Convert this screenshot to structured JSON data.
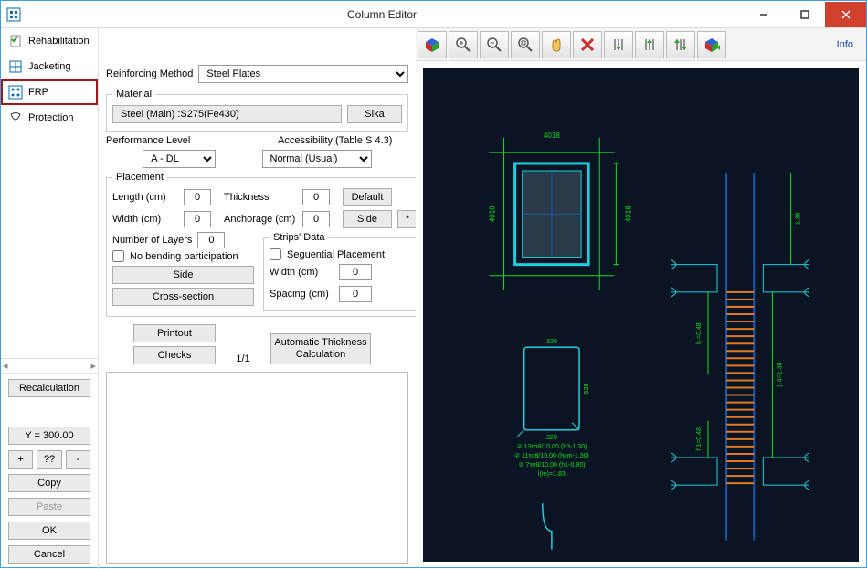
{
  "window": {
    "title": "Column Editor"
  },
  "sidebar": {
    "items": [
      {
        "label": "Rehabilitation"
      },
      {
        "label": "Jacketing"
      },
      {
        "label": "FRP"
      },
      {
        "label": "Protection"
      }
    ],
    "recalc": "Recalculation",
    "y_value": "Y = 300.00",
    "btn_plus": "+",
    "btn_qq": "??",
    "btn_minus": "-",
    "btn_copy": "Copy",
    "btn_paste": "Paste",
    "btn_ok": "OK",
    "btn_cancel": "Cancel"
  },
  "form": {
    "rein_method_lbl": "Reinforcing Method",
    "rein_method_val": "Steel Plates",
    "material_legend": "Material",
    "material_btn": "Steel  (Main) :S275(Fe430)",
    "sika_btn": "Sika",
    "perf_lbl": "Performance Level",
    "perf_val": "A - DL",
    "access_lbl": "Accessibility (Table S 4.3)",
    "access_val": "Normal (Usual)",
    "placement_legend": "Placement",
    "length_lbl": "Length (cm)",
    "length_val": "0",
    "thick_lbl": "Thickness",
    "thick_val": "0",
    "default_btn": "Default",
    "width_lbl": "Width (cm)",
    "width_val": "0",
    "anch_lbl": "Anchorage (cm)",
    "anch_val": "0",
    "side_btn2": "Side",
    "star_btn": "*",
    "layers_lbl": "Number of Layers",
    "layers_val": "0",
    "nobend_lbl": "No bending participation",
    "side_btn": "Side",
    "cross_btn": "Cross-section",
    "strips_legend": "Strips' Data",
    "seq_lbl": "Seguential Placement",
    "swidth_lbl": "Width (cm)",
    "swidth_val": "0",
    "spacing_lbl": "Spacing (cm)",
    "spacing_val": "0",
    "printout_btn": "Printout",
    "checks_btn": "Checks",
    "page_ind": "1/1",
    "auto_thick_btn": "Automatic Thickness Calculation"
  },
  "viewer": {
    "info": "Info",
    "annot1": "② 13τσ8/10.00 (h3-1.30)",
    "annot2": "② 11τσ8/10.00 (hcm-1.30)",
    "annot3": "② 7τσ8/10.00 (h1-0.80)",
    "annot4": "l(m)=1.83",
    "dim_320a": "320",
    "dim_320b": "320",
    "dim_528": "528"
  }
}
